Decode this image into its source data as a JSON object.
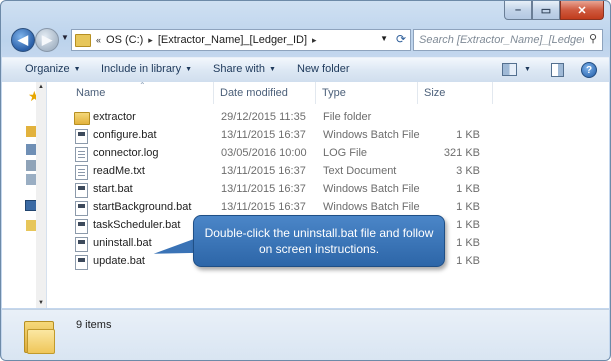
{
  "window": {
    "controls": {
      "minimize": "–",
      "maximize": "▭",
      "close": "✕"
    }
  },
  "address_bar": {
    "chevron": "«",
    "segments": [
      "OS (C:)",
      "[Extractor_Name]_[Ledger_ID]"
    ],
    "separator": "▸"
  },
  "search": {
    "placeholder": "Search [Extractor_Name]_[Ledger_ID]"
  },
  "toolbar": {
    "organize": "Organize",
    "include_in_library": "Include in library",
    "share_with": "Share with",
    "new_folder": "New folder",
    "help": "?"
  },
  "columns": {
    "name": "Name",
    "date_modified": "Date modified",
    "type": "Type",
    "size": "Size"
  },
  "files": [
    {
      "name": "extractor",
      "date": "29/12/2015 11:35",
      "type": "File folder",
      "size": "",
      "icon": "folder-icon"
    },
    {
      "name": "configure.bat",
      "date": "13/11/2015 16:37",
      "type": "Windows Batch File",
      "size": "1 KB",
      "icon": "batch-file-icon"
    },
    {
      "name": "connector.log",
      "date": "03/05/2016 10:00",
      "type": "LOG File",
      "size": "321 KB",
      "icon": "log-file-icon"
    },
    {
      "name": "readMe.txt",
      "date": "13/11/2015 16:37",
      "type": "Text Document",
      "size": "3 KB",
      "icon": "text-file-icon"
    },
    {
      "name": "start.bat",
      "date": "13/11/2015 16:37",
      "type": "Windows Batch File",
      "size": "1 KB",
      "icon": "batch-file-icon"
    },
    {
      "name": "startBackground.bat",
      "date": "13/11/2015 16:37",
      "type": "Windows Batch File",
      "size": "1 KB",
      "icon": "batch-file-icon"
    },
    {
      "name": "taskScheduler.bat",
      "date": "",
      "type": "",
      "size": "1 KB",
      "icon": "batch-file-icon"
    },
    {
      "name": "uninstall.bat",
      "date": "",
      "type": "",
      "size": "1 KB",
      "icon": "batch-file-icon"
    },
    {
      "name": "update.bat",
      "date": "",
      "type": "",
      "size": "1 KB",
      "icon": "batch-file-icon"
    }
  ],
  "callout": {
    "text": "Double-click the uninstall.bat file and follow on screen instructions."
  },
  "details": {
    "count": "9 items"
  },
  "colors": {
    "callout": "#3a73b6",
    "window_frame": "#bcd3ec",
    "folder": "#e2b23d"
  }
}
